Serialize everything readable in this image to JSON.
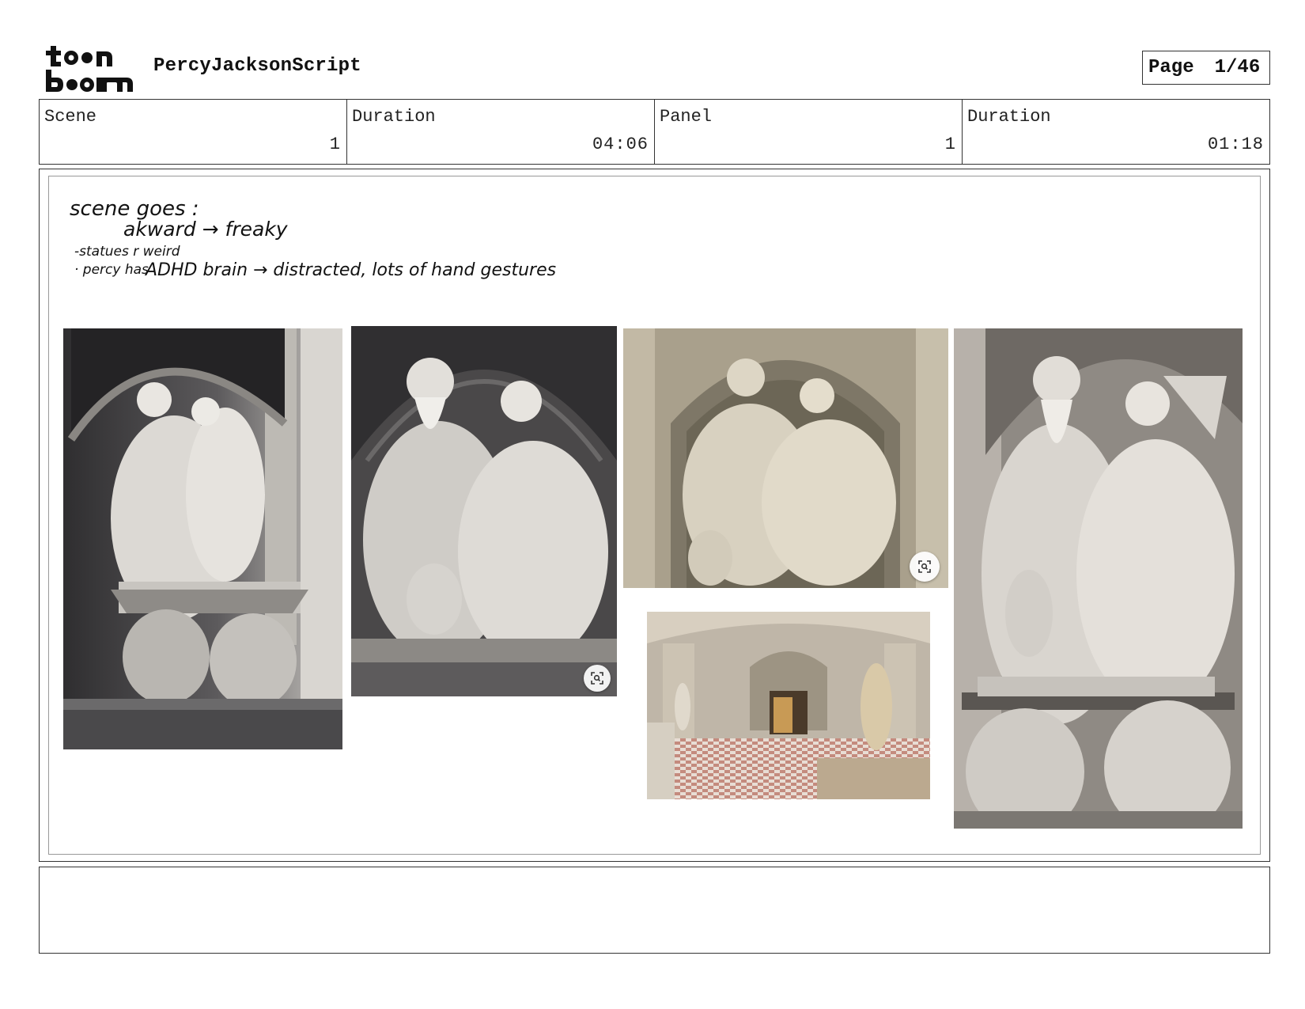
{
  "header": {
    "logo_text": "toonboom",
    "project_title": "PercyJacksonScript",
    "page_label": "Page",
    "page_number": "1/46"
  },
  "info": {
    "scene_label": "Scene",
    "scene_value": "1",
    "scene_duration_label": "Duration",
    "scene_duration_value": "04:06",
    "panel_label": "Panel",
    "panel_value": "1",
    "panel_duration_label": "Duration",
    "panel_duration_value": "01:18"
  },
  "panel": {
    "handwritten_note": {
      "line1": "scene goes :",
      "line2": "akward → freaky",
      "line3": "-statues r weird",
      "line4_prefix": "· percy has",
      "line4_rest": "ADHD brain → distracted, lots of hand gestures"
    },
    "photos": [
      {
        "subject": "marble fountain statue",
        "tone": "grey"
      },
      {
        "subject": "seated bearded god and goddess statue",
        "tone": "grey"
      },
      {
        "subject": "statue pair in shell niche",
        "tone": "beige"
      },
      {
        "subject": "museum gallery with Diana statue",
        "tone": "warm"
      },
      {
        "subject": "fountain statue with atlantes",
        "tone": "grey"
      }
    ],
    "icons": [
      "visual-search-icon",
      "visual-search-icon"
    ]
  },
  "dialogue": {
    "text": ""
  }
}
